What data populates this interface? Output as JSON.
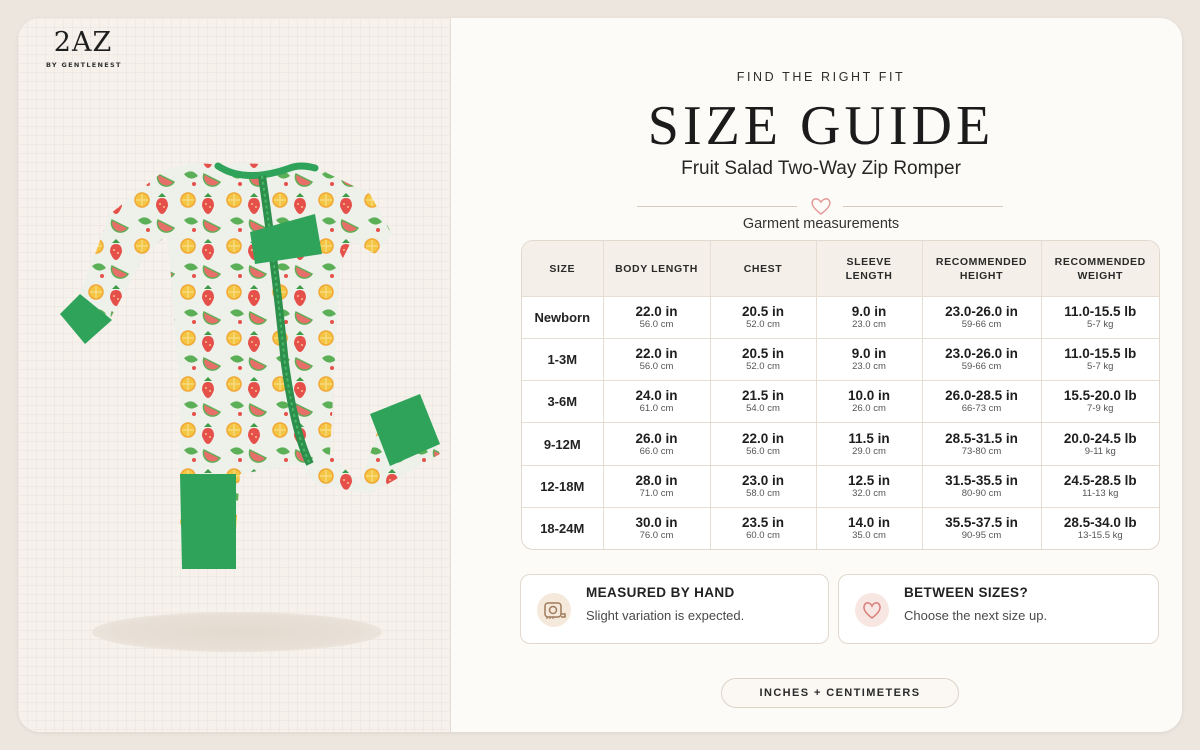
{
  "brand": {
    "name": "2AZ",
    "tagline": "BY GENTLENEST"
  },
  "header": {
    "eyebrow": "FIND THE RIGHT FIT",
    "title": "SIZE GUIDE",
    "product": "Fruit Salad Two-Way Zip Romper",
    "caption": "Garment measurements"
  },
  "table": {
    "headers": [
      "SIZE",
      "BODY LENGTH",
      "CHEST",
      "SLEEVE LENGTH",
      "RECOMMENDED HEIGHT",
      "RECOMMENDED WEIGHT"
    ],
    "rows": [
      {
        "size": "Newborn",
        "body": [
          "22.0 in",
          "56.0 cm"
        ],
        "chest": [
          "20.5 in",
          "52.0 cm"
        ],
        "sleeve": [
          "9.0 in",
          "23.0 cm"
        ],
        "height": [
          "23.0-26.0 in",
          "59-66 cm"
        ],
        "weight": [
          "11.0-15.5 lb",
          "5-7 kg"
        ]
      },
      {
        "size": "1-3M",
        "body": [
          "22.0 in",
          "56.0 cm"
        ],
        "chest": [
          "20.5 in",
          "52.0 cm"
        ],
        "sleeve": [
          "9.0 in",
          "23.0 cm"
        ],
        "height": [
          "23.0-26.0 in",
          "59-66 cm"
        ],
        "weight": [
          "11.0-15.5 lb",
          "5-7 kg"
        ]
      },
      {
        "size": "3-6M",
        "body": [
          "24.0 in",
          "61.0 cm"
        ],
        "chest": [
          "21.5 in",
          "54.0 cm"
        ],
        "sleeve": [
          "10.0 in",
          "26.0 cm"
        ],
        "height": [
          "26.0-28.5 in",
          "66-73 cm"
        ],
        "weight": [
          "15.5-20.0 lb",
          "7-9 kg"
        ]
      },
      {
        "size": "9-12M",
        "body": [
          "26.0 in",
          "66.0 cm"
        ],
        "chest": [
          "22.0 in",
          "56.0 cm"
        ],
        "sleeve": [
          "11.5 in",
          "29.0 cm"
        ],
        "height": [
          "28.5-31.5 in",
          "73-80 cm"
        ],
        "weight": [
          "20.0-24.5 lb",
          "9-11 kg"
        ]
      },
      {
        "size": "12-18M",
        "body": [
          "28.0 in",
          "71.0 cm"
        ],
        "chest": [
          "23.0 in",
          "58.0 cm"
        ],
        "sleeve": [
          "12.5 in",
          "32.0 cm"
        ],
        "height": [
          "31.5-35.5 in",
          "80-90 cm"
        ],
        "weight": [
          "24.5-28.5 lb",
          "11-13 kg"
        ]
      },
      {
        "size": "18-24M",
        "body": [
          "30.0 in",
          "76.0 cm"
        ],
        "chest": [
          "23.5 in",
          "60.0 cm"
        ],
        "sleeve": [
          "14.0 in",
          "35.0 cm"
        ],
        "height": [
          "35.5-37.5 in",
          "90-95 cm"
        ],
        "weight": [
          "28.5-34.0 lb",
          "13-15.5 kg"
        ]
      }
    ]
  },
  "notes": [
    {
      "title": "MEASURED BY HAND",
      "text": "Slight variation is expected.",
      "icon": "tape-measure-icon"
    },
    {
      "title": "BETWEEN SIZES?",
      "text": "Choose the next size up.",
      "icon": "heart-icon"
    }
  ],
  "units_label": "INCHES + CENTIMETERS",
  "colors": {
    "accent_green": "#2fa35a",
    "heart": "#e39a9a",
    "note_icon_bg": "#f7e6e1",
    "header_bg": "#f4efe9"
  }
}
